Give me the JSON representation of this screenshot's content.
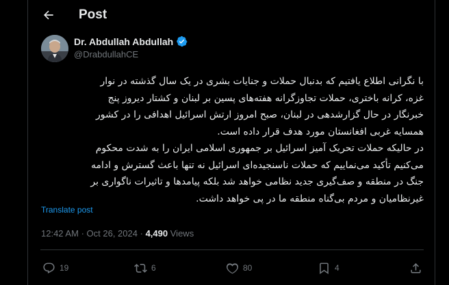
{
  "header": {
    "title": "Post"
  },
  "author": {
    "name": "Dr. Abdullah Abdullah",
    "handle": "@DrabdullahCE"
  },
  "post": {
    "lines": [
      "با نگرانی اطلاع یافتیم که بدنبال حملات و جنایات بشری در یک سال گذشته در نوار",
      "غزه، کرانه باختری، حملات تجاوزگرانه هفته‌های پسین بر لبنان و کشتار دیروز پنج",
      "خبرنگار در حال گزارشدهی در لبنان، صبح امروز ارتش اسرائیل اهدافی را در کشور",
      "همسایه غربی افغانستان مورد هدف قرار داده است.",
      "در حالیکه حملات تحریک آمیز اسرائیل بر جمهوری اسلامی ایران را به شدت محکوم",
      "می‌کنیم تأکید می‌نماییم که حملات ناسنجیده‌ای اسرائیل نه تنها باعث گسترش و ادامه",
      "جنگ در منطقه و صف‌گیری جدید نظامی خواهد شد بلکه پیامدها و تاثیرات ناگواری بر",
      "غیرنظامیان و مردم بی‌گناه منطقه ما در پی خواهد داشت."
    ],
    "translate_label": "Translate post",
    "time": "12:42 AM",
    "separator": "·",
    "date": "Oct 26, 2024",
    "views_count": "4,490",
    "views_label": "Views"
  },
  "actions": {
    "replies": "19",
    "reposts": "6",
    "likes": "80",
    "bookmarks": "4"
  },
  "colors": {
    "background": "#000000",
    "text": "#e7e9ea",
    "muted": "#71767b",
    "accent": "#1d9bf0",
    "border": "#2f3336"
  },
  "icons": {
    "back": "arrow-left-icon",
    "verified": "verified-badge-icon",
    "reply": "reply-icon",
    "repost": "repost-icon",
    "like": "heart-icon",
    "bookmark": "bookmark-icon",
    "share": "share-icon"
  }
}
